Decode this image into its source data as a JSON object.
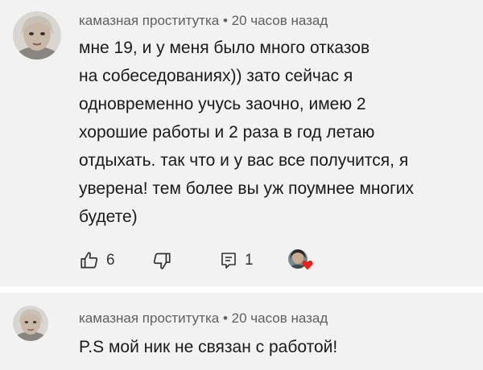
{
  "comments": [
    {
      "author": "камазная проститутка",
      "separator": " • ",
      "time": "20 часов назад",
      "text_lines": [
        "мне 19, и у меня было много отказов",
        "на собеседованиях)) зато сейчас я",
        "одновременно учусь заочно, имею 2",
        "хорошие работы и 2 раза в год летаю",
        "отдыхать. так что и у вас все получится, я",
        "уверена! тем более вы уж поумнее многих",
        "будете)"
      ],
      "likes": "6",
      "replies": "1",
      "icons": {
        "like": "thumbs-up-icon",
        "dislike": "thumbs-down-icon",
        "reply": "reply-icon",
        "heart": "creator-heart-icon"
      },
      "heart_color": "#e62117"
    },
    {
      "author": "камазная проститутка",
      "separator": " • ",
      "time": "20 часов назад",
      "text_lines": [
        "P.S мой ник не связан с работой!"
      ]
    }
  ]
}
